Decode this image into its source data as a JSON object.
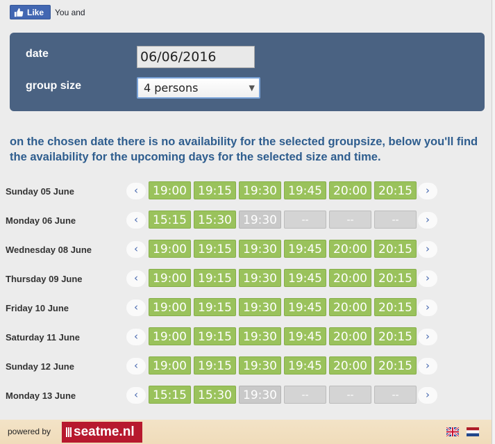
{
  "facebook": {
    "like_label": "Like",
    "text": "You and"
  },
  "form": {
    "date_label": "date",
    "date_value": "06/06/2016",
    "group_label": "group size",
    "group_value": "4 persons"
  },
  "message": "on the chosen date there is no availability for the selected groupsize, below you'll find the availability for the upcoming days for the selected size and time.",
  "nav": {
    "prev": "‹",
    "next": "›"
  },
  "days": [
    {
      "label": "Sunday 05 June",
      "slots": [
        {
          "t": "19:00",
          "s": "avail"
        },
        {
          "t": "19:15",
          "s": "avail"
        },
        {
          "t": "19:30",
          "s": "avail"
        },
        {
          "t": "19:45",
          "s": "avail"
        },
        {
          "t": "20:00",
          "s": "avail"
        },
        {
          "t": "20:15",
          "s": "avail"
        }
      ]
    },
    {
      "label": "Monday 06 June",
      "slots": [
        {
          "t": "15:15",
          "s": "avail"
        },
        {
          "t": "15:30",
          "s": "avail"
        },
        {
          "t": "19:30",
          "s": "taken"
        },
        {
          "t": "--",
          "s": "none"
        },
        {
          "t": "--",
          "s": "none"
        },
        {
          "t": "--",
          "s": "none"
        }
      ]
    },
    {
      "label": "Wednesday 08 June",
      "slots": [
        {
          "t": "19:00",
          "s": "avail"
        },
        {
          "t": "19:15",
          "s": "avail"
        },
        {
          "t": "19:30",
          "s": "avail"
        },
        {
          "t": "19:45",
          "s": "avail"
        },
        {
          "t": "20:00",
          "s": "avail"
        },
        {
          "t": "20:15",
          "s": "avail"
        }
      ]
    },
    {
      "label": "Thursday 09 June",
      "slots": [
        {
          "t": "19:00",
          "s": "avail"
        },
        {
          "t": "19:15",
          "s": "avail"
        },
        {
          "t": "19:30",
          "s": "avail"
        },
        {
          "t": "19:45",
          "s": "avail"
        },
        {
          "t": "20:00",
          "s": "avail"
        },
        {
          "t": "20:15",
          "s": "avail"
        }
      ]
    },
    {
      "label": "Friday 10 June",
      "slots": [
        {
          "t": "19:00",
          "s": "avail"
        },
        {
          "t": "19:15",
          "s": "avail"
        },
        {
          "t": "19:30",
          "s": "avail"
        },
        {
          "t": "19:45",
          "s": "avail"
        },
        {
          "t": "20:00",
          "s": "avail"
        },
        {
          "t": "20:15",
          "s": "avail"
        }
      ]
    },
    {
      "label": "Saturday 11 June",
      "slots": [
        {
          "t": "19:00",
          "s": "avail"
        },
        {
          "t": "19:15",
          "s": "avail"
        },
        {
          "t": "19:30",
          "s": "avail"
        },
        {
          "t": "19:45",
          "s": "avail"
        },
        {
          "t": "20:00",
          "s": "avail"
        },
        {
          "t": "20:15",
          "s": "avail"
        }
      ]
    },
    {
      "label": "Sunday 12 June",
      "slots": [
        {
          "t": "19:00",
          "s": "avail"
        },
        {
          "t": "19:15",
          "s": "avail"
        },
        {
          "t": "19:30",
          "s": "avail"
        },
        {
          "t": "19:45",
          "s": "avail"
        },
        {
          "t": "20:00",
          "s": "avail"
        },
        {
          "t": "20:15",
          "s": "avail"
        }
      ]
    },
    {
      "label": "Monday 13 June",
      "slots": [
        {
          "t": "15:15",
          "s": "avail"
        },
        {
          "t": "15:30",
          "s": "avail"
        },
        {
          "t": "19:30",
          "s": "taken"
        },
        {
          "t": "--",
          "s": "none"
        },
        {
          "t": "--",
          "s": "none"
        },
        {
          "t": "--",
          "s": "none"
        }
      ]
    }
  ],
  "footer": {
    "powered_by": "powered by",
    "logo_text": "seatme.nl"
  },
  "colors": {
    "panel": "#4a6282",
    "available": "#9ac25c",
    "unavailable": "#c9c9c9",
    "message": "#2e5d8e",
    "brand": "#b7192e"
  },
  "icons": {
    "like": "thumbs-up-icon",
    "prev": "chevron-left-icon",
    "next": "chevron-right-icon",
    "flag_en": "uk-flag-icon",
    "flag_nl": "nl-flag-icon"
  }
}
